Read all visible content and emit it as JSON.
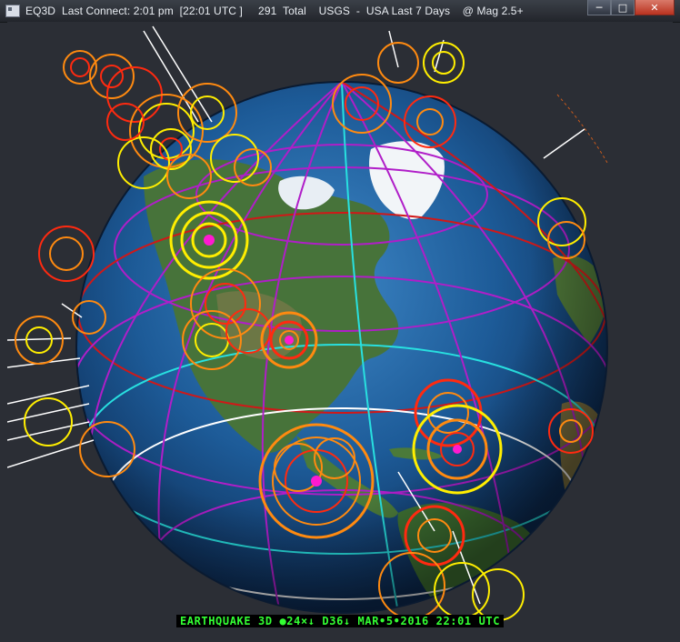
{
  "window": {
    "title": "EQ3D  Last Connect: 2:01 pm  [22:01 UTC ]     291  Total    USGS  -  USA Last 7 Days    @ Mag 2.5+",
    "app_icon": "eq3d-app-icon",
    "controls": {
      "minimize": "─",
      "maximize": "□",
      "close": "✕"
    }
  },
  "status": {
    "text": "EARTHQUAKE 3D ●24×↓ D36↓ MAR•5•2016 22:01 UTC"
  },
  "colors": {
    "ocean": "#1f5e9e",
    "land": "#3d6a2f",
    "ice": "#ffffff",
    "grid_magenta": "#b01ec8",
    "grid_red": "#d01818",
    "grid_cyan": "#28e0e0",
    "status_green": "#33ff33",
    "quake_yellow": "#ffee00",
    "quake_orange": "#ff8a10",
    "quake_red": "#ff2a10"
  }
}
